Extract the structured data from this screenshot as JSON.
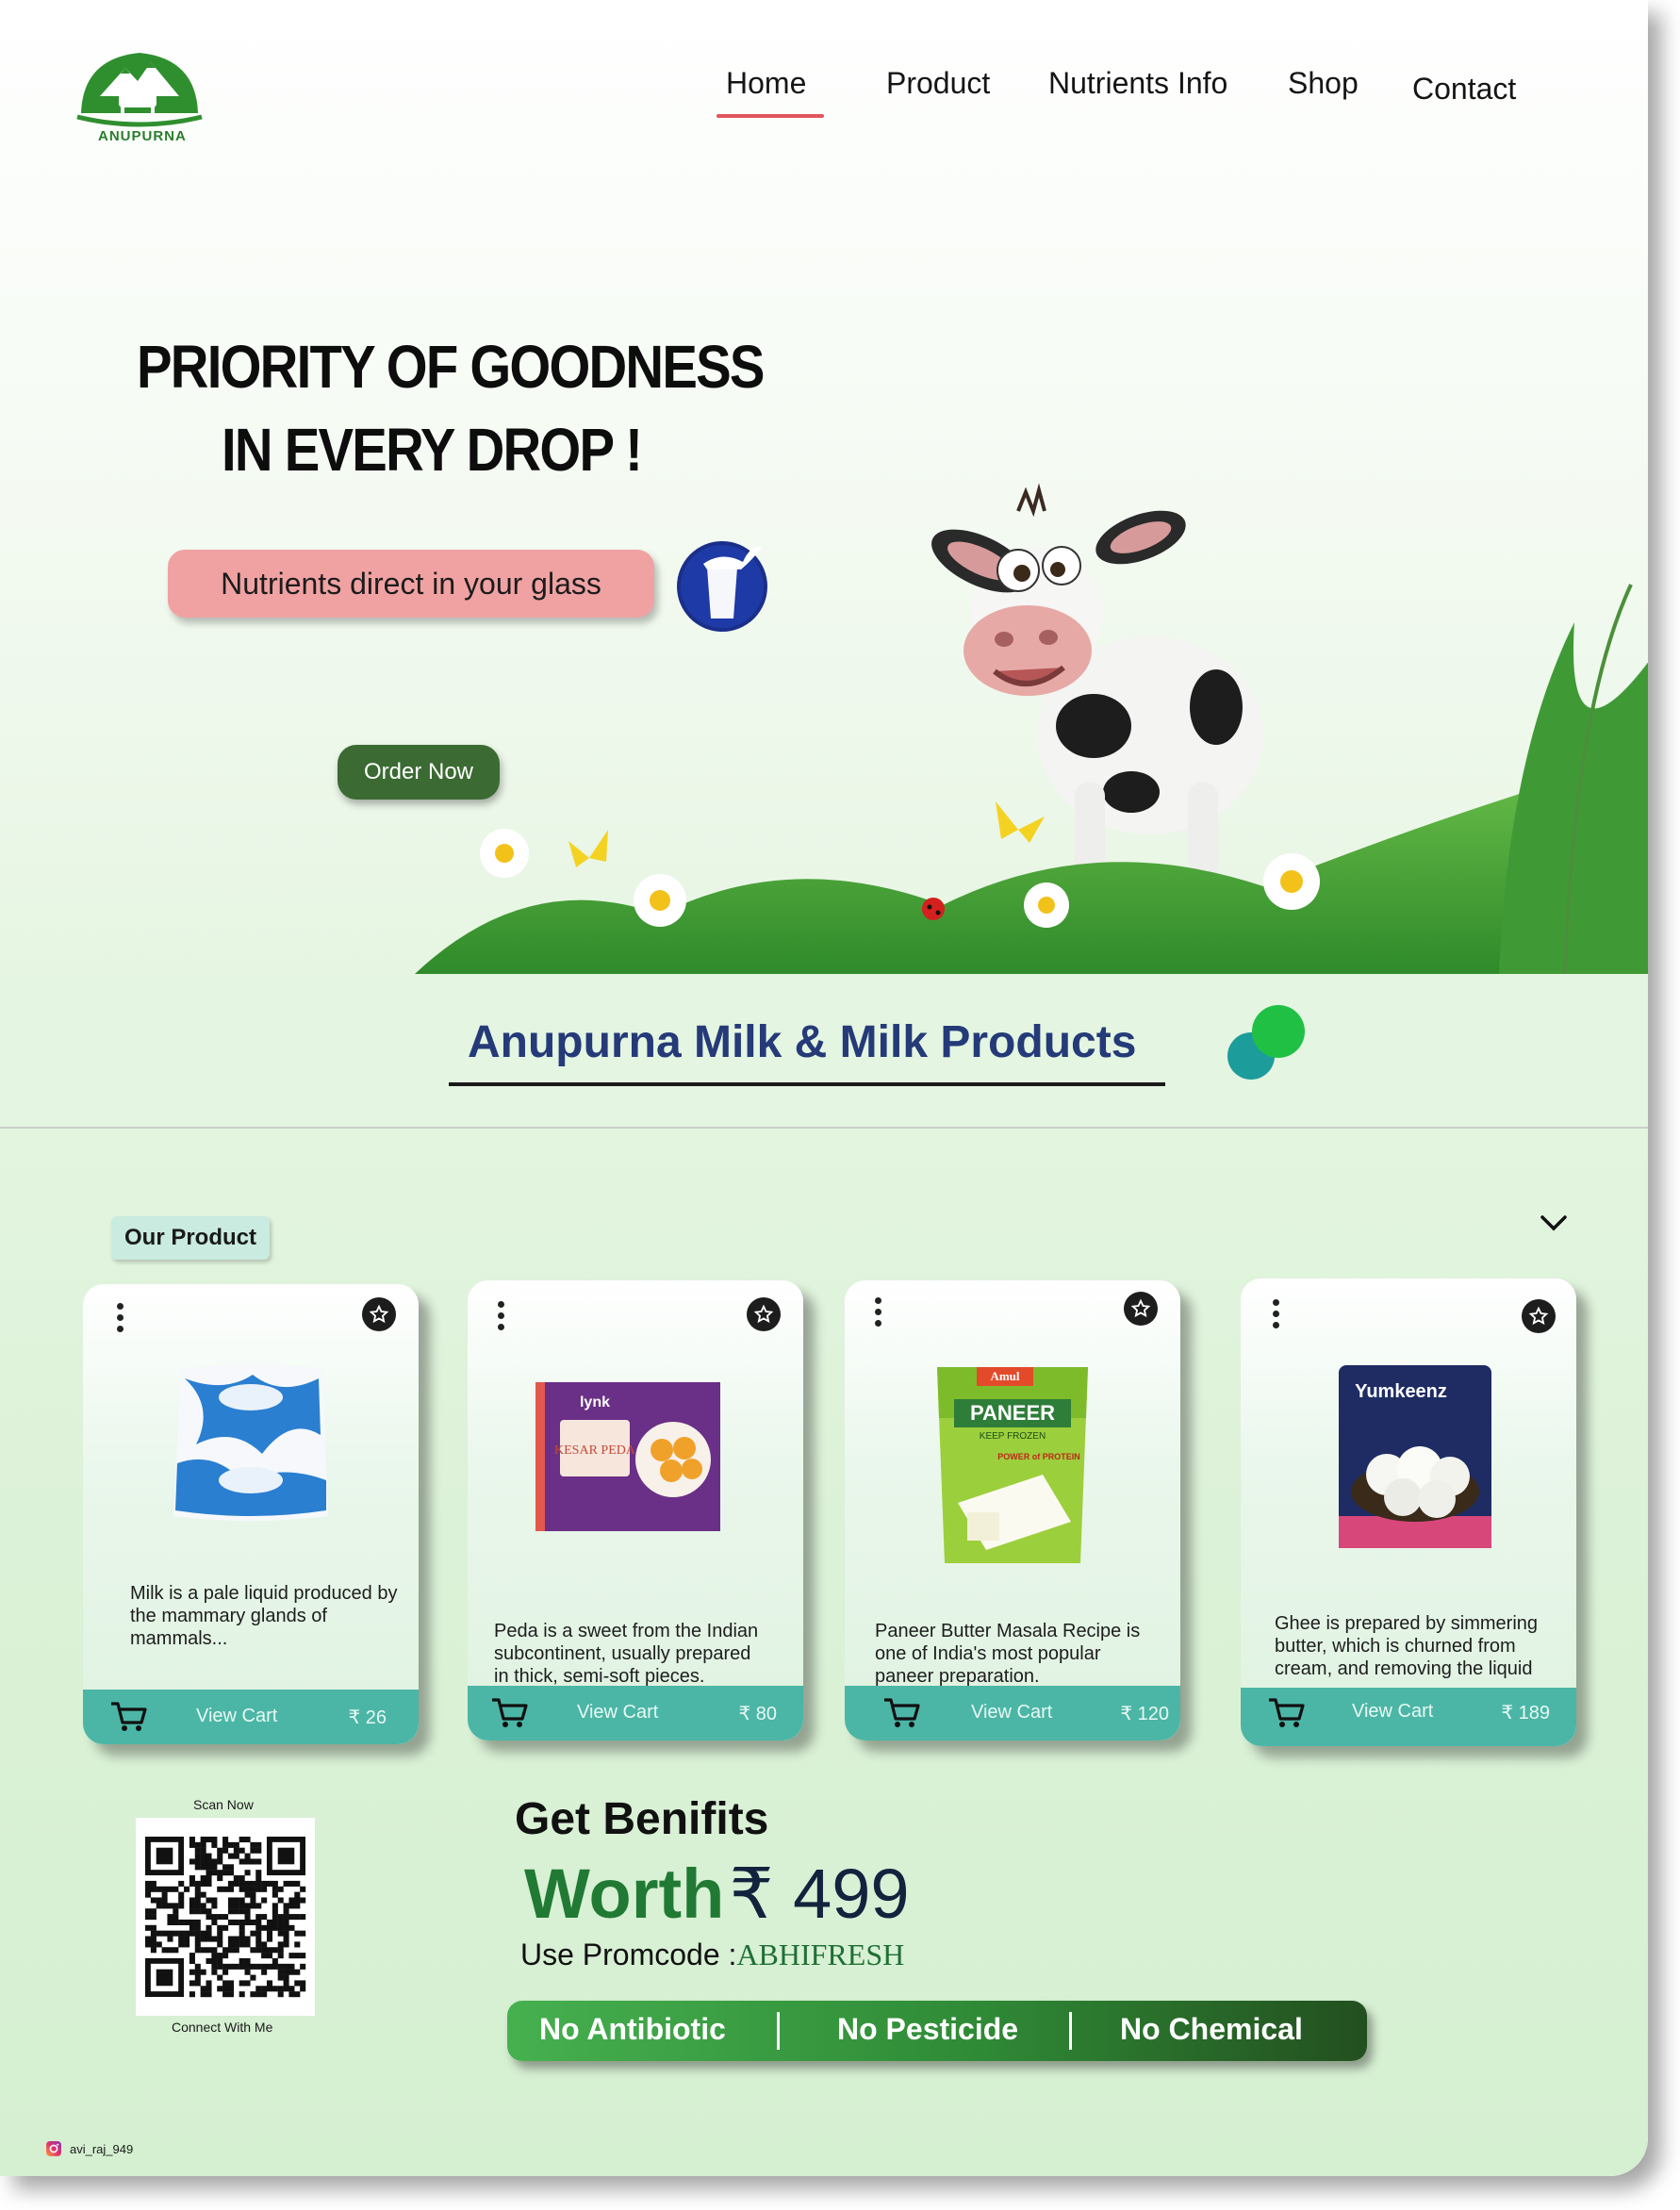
{
  "brand": {
    "name": "ANUPURNA"
  },
  "nav": {
    "items": [
      "Home",
      "Product",
      "Nutrients Info",
      "Shop",
      "Contact"
    ],
    "active": "Home"
  },
  "hero": {
    "title_line1": "PRIORITY OF GOODNESS",
    "title_line2": "IN EVERY DROP !",
    "tagline": "Nutrients direct in your glass",
    "cta": "Order Now"
  },
  "section": {
    "title": "Anupurna Milk & Milk Products"
  },
  "products": {
    "heading": "Our Product",
    "items": [
      {
        "desc": "Milk is a pale liquid produced by the mammary glands of mammals...",
        "cart_label": "View Cart",
        "price": "₹ 26",
        "image": "milk-pouch"
      },
      {
        "desc": "Peda is a sweet from the Indian subcontinent, usually prepared in thick, semi-soft pieces.",
        "cart_label": "View Cart",
        "price": "₹ 80",
        "image": "kesar-peda-box",
        "box_brand": "lynk",
        "box_text": "KESAR PEDA"
      },
      {
        "desc": "Paneer Butter Masala Recipe is one of India's most popular paneer preparation.",
        "cart_label": "View Cart",
        "price": "₹ 120",
        "image": "paneer-pack",
        "pack_brand": "Amul",
        "pack_text": "PANEER",
        "pack_sub": "KEEP FROZEN",
        "pack_badge": "POWER of PROTEIN"
      },
      {
        "desc": "Ghee is prepared by simmering butter, which is churned from cream, and removing the liquid residue.",
        "cart_label": "View Cart",
        "price": "₹ 189",
        "image": "rasgulla-tin",
        "tin_brand": "Yumkeenz"
      }
    ]
  },
  "qr": {
    "top_label": "Scan Now",
    "bottom_label": "Connect With Me"
  },
  "offer": {
    "title": "Get Benifits",
    "worth_word": "Worth",
    "worth_price": "₹ 499",
    "promo_prefix": "Use Promcode :",
    "promo_code": "ABHIFRESH",
    "badges": [
      "No Antibiotic",
      "No Pesticide",
      "No Chemical"
    ]
  },
  "social": {
    "handle": "avi_raj_949",
    "icon": "instagram-icon"
  },
  "colors": {
    "accent": "#e0565c",
    "brand_green": "#3b6b33",
    "card_bar": "#4bb6a6",
    "title_blue": "#253a78"
  }
}
